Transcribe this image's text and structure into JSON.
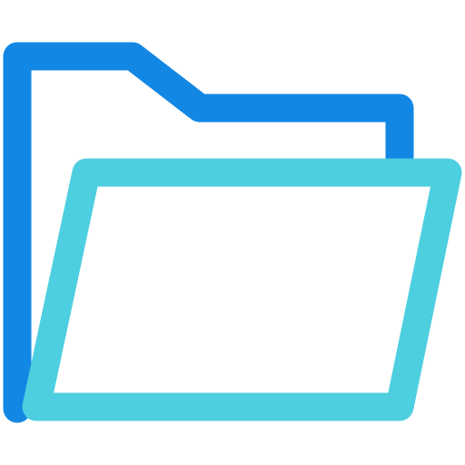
{
  "icon": {
    "name": "open-folder-icon",
    "colors": {
      "back": "#1387E4",
      "front": "#4ECFDF",
      "background": "#FFFFFF"
    }
  }
}
